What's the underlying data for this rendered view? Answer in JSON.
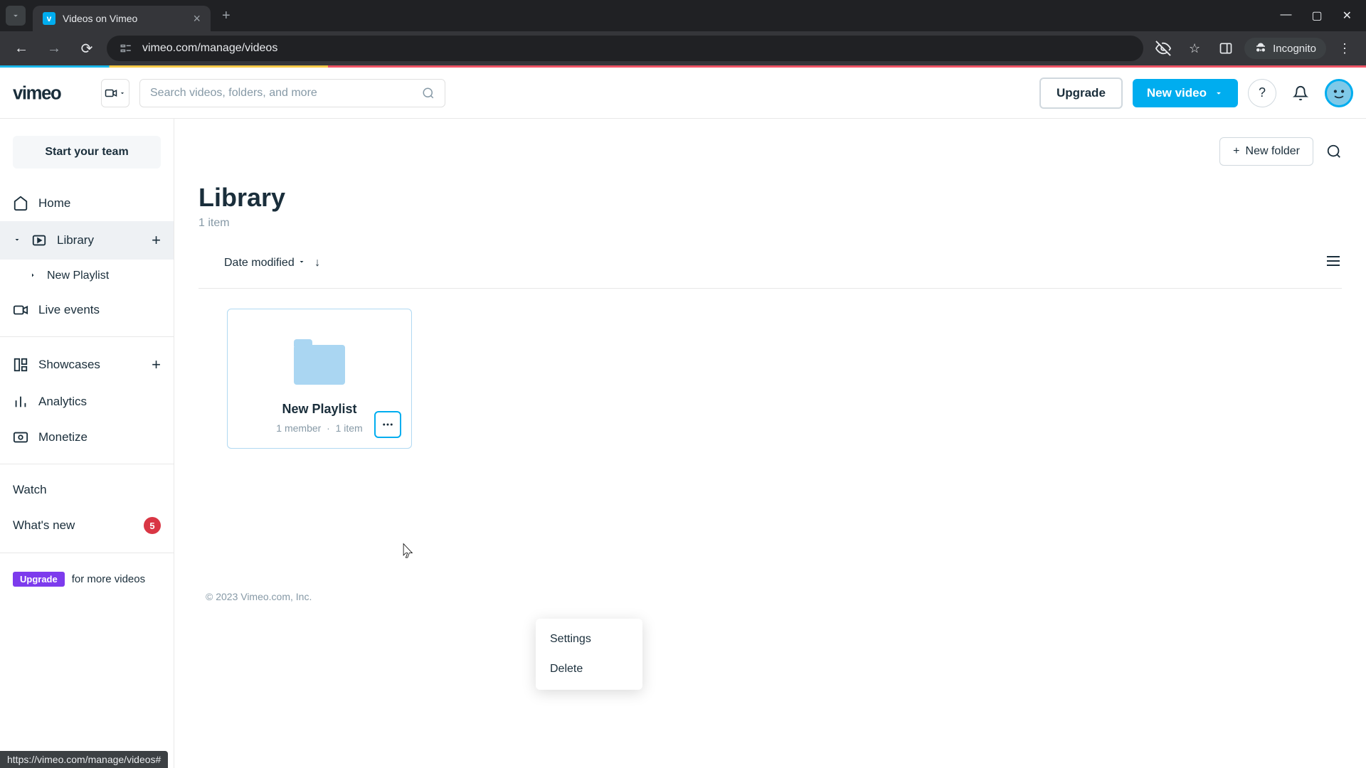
{
  "browser": {
    "tab_title": "Videos on Vimeo",
    "url": "vimeo.com/manage/videos",
    "incognito_label": "Incognito",
    "status_url": "https://vimeo.com/manage/videos#"
  },
  "header": {
    "search_placeholder": "Search videos, folders, and more",
    "upgrade_label": "Upgrade",
    "new_video_label": "New video"
  },
  "sidebar": {
    "team_button": "Start your team",
    "items": {
      "home": "Home",
      "library": "Library",
      "new_playlist": "New Playlist",
      "live_events": "Live events",
      "showcases": "Showcases",
      "analytics": "Analytics",
      "monetize": "Monetize",
      "watch": "Watch",
      "whats_new": "What's new",
      "whats_new_badge": "5"
    },
    "upgrade": {
      "pill": "Upgrade",
      "text": "for more videos"
    }
  },
  "main": {
    "new_folder_label": "New folder",
    "page_title": "Library",
    "item_count": "1 item",
    "sort_label": "Date modified",
    "card": {
      "title": "New Playlist",
      "members": "1 member",
      "separator": "·",
      "items": "1 item"
    },
    "context_menu": {
      "settings": "Settings",
      "delete": "Delete"
    },
    "footer_copyright": "© 2023 Vimeo.com, Inc."
  }
}
